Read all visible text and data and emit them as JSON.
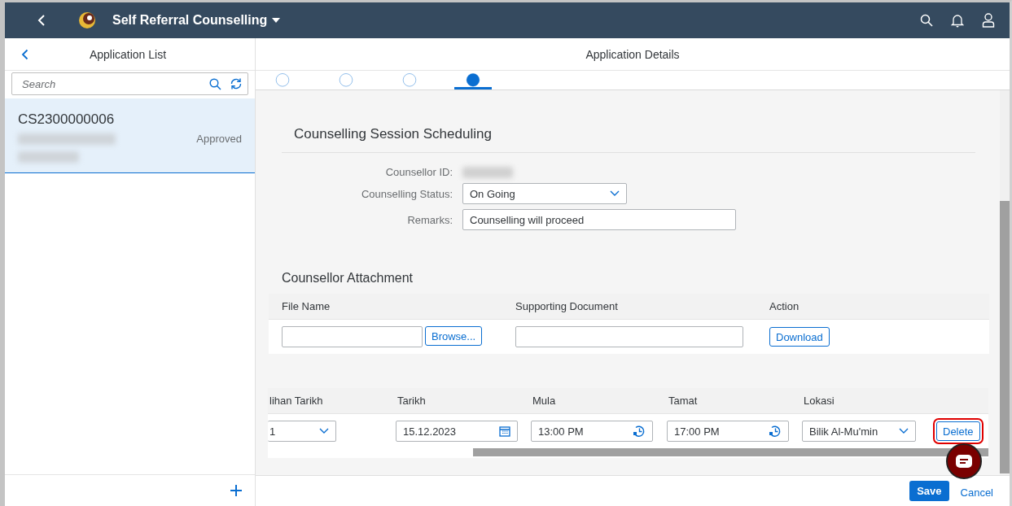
{
  "shell": {
    "title": "Self Referral Counselling"
  },
  "master": {
    "title": "Application List",
    "search": {
      "placeholder": "Search"
    },
    "items": [
      {
        "id": "CS2300000006",
        "status": "Approved",
        "selected": true
      }
    ]
  },
  "detail": {
    "title": "Application Details",
    "steps": [
      {
        "selected": false
      },
      {
        "selected": false
      },
      {
        "selected": false
      },
      {
        "selected": true
      }
    ],
    "scheduling": {
      "title": "Counselling Session Scheduling",
      "fields": [
        {
          "label": "Counsellor ID:",
          "kind": "redacted"
        },
        {
          "label": "Counselling Status:",
          "kind": "select",
          "value": "On Going"
        },
        {
          "label": "Remarks:",
          "kind": "input",
          "value": "Counselling will proceed"
        }
      ]
    },
    "attachment": {
      "title": "Counsellor Attachment",
      "columns": [
        "File Name",
        "Supporting Document",
        "Action"
      ],
      "browse": "Browse...",
      "download": "Download"
    },
    "schedule": {
      "columns": [
        "lihan Tarikh",
        "Tarikh",
        "Mula",
        "Tamat",
        "Lokasi"
      ],
      "rows": [
        {
          "cells": [
            {
              "kind": "select",
              "value": "1"
            },
            {
              "kind": "date",
              "value": "15.12.2023"
            },
            {
              "kind": "time",
              "value": "13:00 PM"
            },
            {
              "kind": "time",
              "value": "17:00 PM"
            },
            {
              "kind": "select",
              "value": "Bilik Al-Mu'min"
            }
          ],
          "action": "Delete",
          "highlighted": true
        }
      ]
    },
    "footer": {
      "save": "Save",
      "cancel": "Cancel"
    }
  }
}
